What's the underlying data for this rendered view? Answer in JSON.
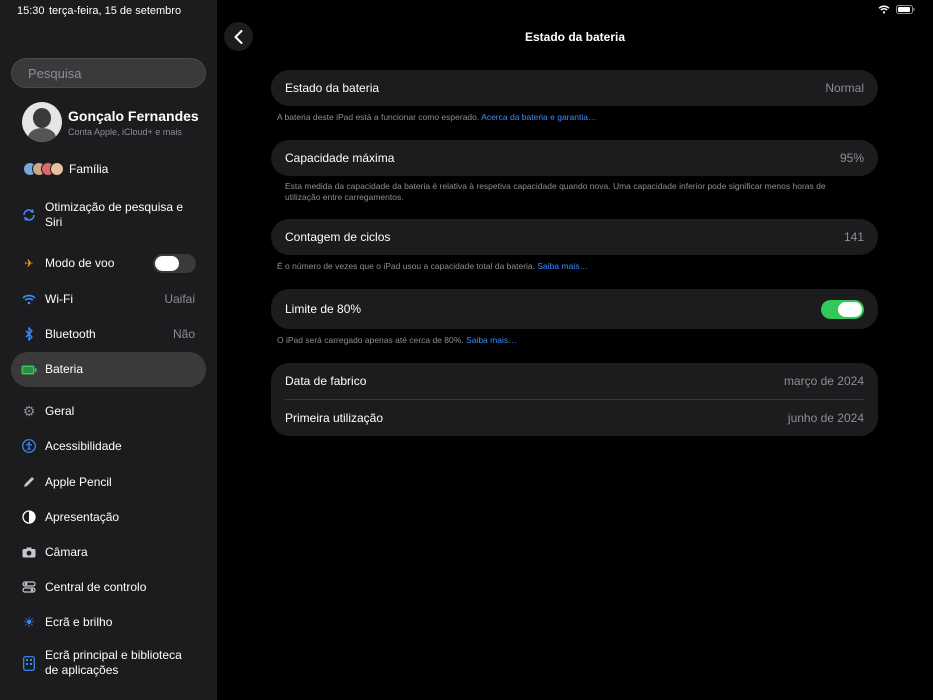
{
  "status": {
    "time": "15:30",
    "date": "terça-feira, 15 de setembro"
  },
  "sidebar": {
    "search_placeholder": "Pesquisa",
    "profile": {
      "name": "Gonçalo Fernandes",
      "subtitle": "Conta Apple, iCloud+ e mais"
    },
    "family_label": "Família",
    "items": [
      {
        "label": "Otimização de pesquisa e Siri",
        "icon": "siri-icon"
      },
      {
        "label": "Modo de voo",
        "icon": "airplane-icon",
        "toggle": false
      },
      {
        "label": "Wi-Fi",
        "value": "Uaifai",
        "icon": "wifi-icon"
      },
      {
        "label": "Bluetooth",
        "value": "Não",
        "icon": "bluetooth-icon"
      },
      {
        "label": "Bateria",
        "icon": "battery-icon",
        "selected": true
      },
      {
        "label": "Geral",
        "icon": "gear-icon"
      },
      {
        "label": "Acessibilidade",
        "icon": "accessibility-icon"
      },
      {
        "label": "Apple Pencil",
        "icon": "pencil-icon"
      },
      {
        "label": "Apresentação",
        "icon": "appearance-icon"
      },
      {
        "label": "Câmara",
        "icon": "camera-icon"
      },
      {
        "label": "Central de controlo",
        "icon": "control-center-icon"
      },
      {
        "label": "Ecrã e brilho",
        "icon": "brightness-icon"
      },
      {
        "label": "Ecrã principal e biblioteca de aplicações",
        "icon": "home-screen-icon"
      }
    ]
  },
  "main": {
    "title": "Estado da bateria",
    "state": {
      "label": "Estado da bateria",
      "value": "Normal"
    },
    "state_note": "A bateria deste iPad está a funcionar como esperado.",
    "state_link": "Acerca da bateria e garantia…",
    "capacity": {
      "label": "Capacidade máxima",
      "value": "95%"
    },
    "capacity_note": "Esta medida da capacidade da bateria é relativa à respetiva capacidade quando nova. Uma capacidade inferior pode significar menos horas de utilização entre carregamentos.",
    "cycles": {
      "label": "Contagem de ciclos",
      "value": "141"
    },
    "cycles_note": "É o número de vezes que o iPad usou a capacidade total da bateria.",
    "cycles_link": "Saiba mais…",
    "limit": {
      "label": "Limite de 80%",
      "on": true
    },
    "limit_note": "O iPad será carregado apenas até cerca de 80%.",
    "limit_link": "Saiba mais…",
    "manufacture": {
      "label": "Data de fabrico",
      "value": "março de 2024"
    },
    "first_use": {
      "label": "Primeira utilização",
      "value": "junho de 2024"
    }
  },
  "colors": {
    "accent_green": "#34c759",
    "link_blue": "#3a8dff",
    "sidebar_bg": "#1c1c1e"
  }
}
